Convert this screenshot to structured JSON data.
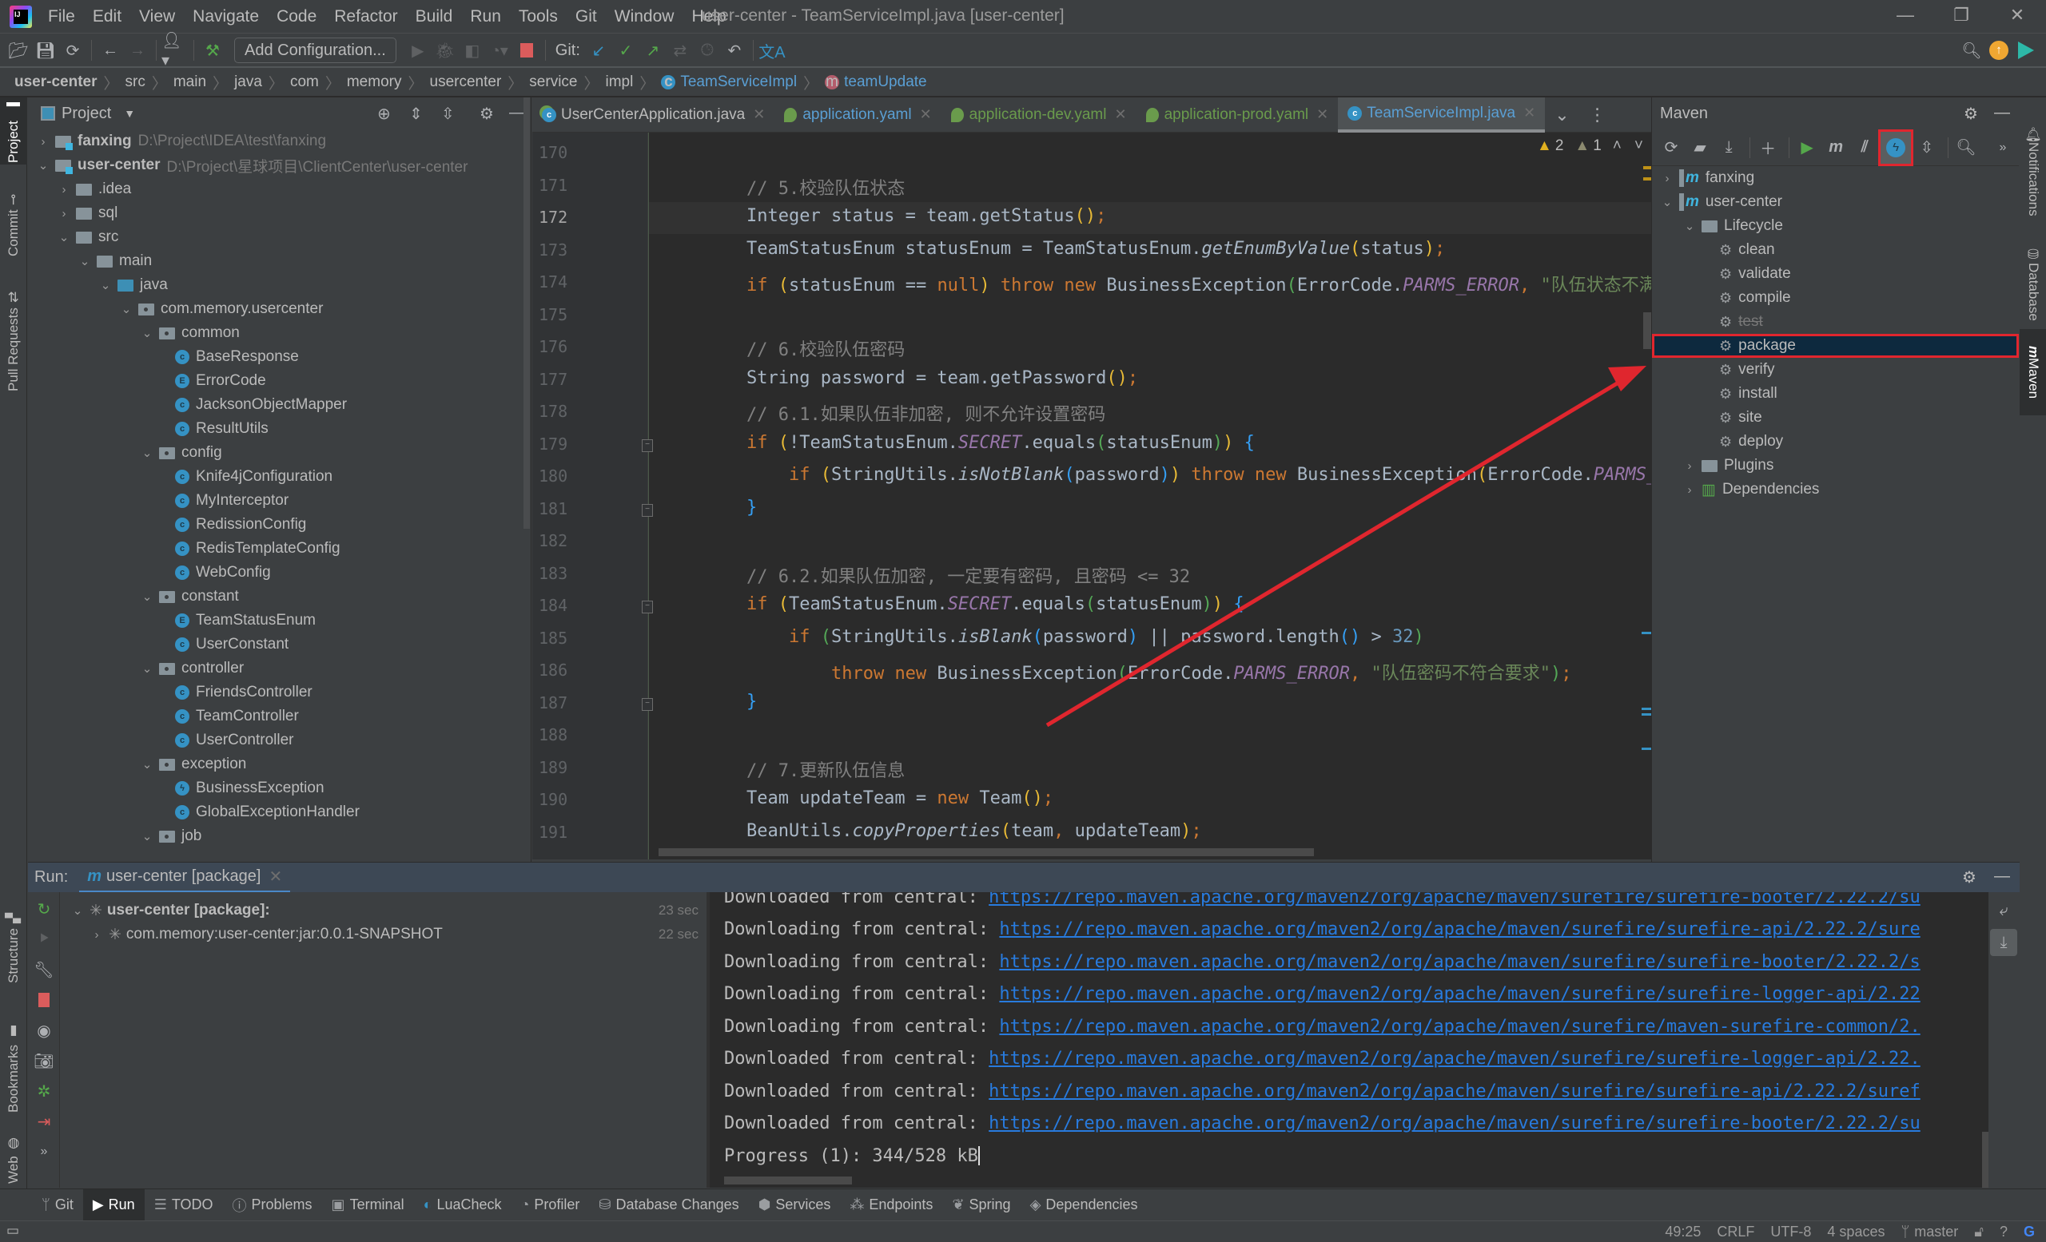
{
  "window": {
    "title": "user-center - TeamServiceImpl.java [user-center]",
    "menu": [
      "File",
      "Edit",
      "View",
      "Navigate",
      "Code",
      "Refactor",
      "Build",
      "Run",
      "Tools",
      "Git",
      "Window",
      "Help"
    ],
    "controls": {
      "minimize": "—",
      "restore": "❐",
      "close": "✕"
    }
  },
  "toolbar": {
    "add_configuration": "Add Configuration...",
    "git_label": "Git:"
  },
  "breadcrumb": {
    "items": [
      "user-center",
      "src",
      "main",
      "java",
      "com",
      "memory",
      "usercenter",
      "service",
      "impl",
      "TeamServiceImpl",
      "teamUpdate"
    ]
  },
  "left_stripe": {
    "project": "Project",
    "commit": "Commit",
    "pull_requests": "Pull Requests",
    "structure": "Structure",
    "bookmarks": "Bookmarks",
    "web": "Web"
  },
  "right_stripe": {
    "notifications": "Notifications",
    "database": "Database",
    "maven": "Maven"
  },
  "project_panel": {
    "title": "Project",
    "tree": [
      {
        "label": "fanxing",
        "path": "D:\\Project\\IDEA\\test\\fanxing",
        "type": "module",
        "expanded": false,
        "depth": 0
      },
      {
        "label": "user-center",
        "path": "D:\\Project\\星球项目\\ClientCenter\\user-center",
        "type": "module",
        "expanded": true,
        "depth": 0
      },
      {
        "label": ".idea",
        "type": "folder",
        "expanded": false,
        "depth": 1
      },
      {
        "label": "sql",
        "type": "folder",
        "expanded": false,
        "depth": 1
      },
      {
        "label": "src",
        "type": "folder",
        "expanded": true,
        "depth": 1
      },
      {
        "label": "main",
        "type": "folder",
        "expanded": true,
        "depth": 2
      },
      {
        "label": "java",
        "type": "source",
        "expanded": true,
        "depth": 3
      },
      {
        "label": "com.memory.usercenter",
        "type": "package",
        "expanded": true,
        "depth": 4
      },
      {
        "label": "common",
        "type": "package",
        "expanded": true,
        "depth": 5
      },
      {
        "label": "BaseResponse",
        "type": "class",
        "depth": 6
      },
      {
        "label": "ErrorCode",
        "type": "enum",
        "depth": 6
      },
      {
        "label": "JacksonObjectMapper",
        "type": "class",
        "depth": 6
      },
      {
        "label": "ResultUtils",
        "type": "class",
        "depth": 6
      },
      {
        "label": "config",
        "type": "package",
        "expanded": true,
        "depth": 5
      },
      {
        "label": "Knife4jConfiguration",
        "type": "class",
        "depth": 6
      },
      {
        "label": "MyInterceptor",
        "type": "class",
        "depth": 6
      },
      {
        "label": "RedissionConfig",
        "type": "class",
        "depth": 6
      },
      {
        "label": "RedisTemplateConfig",
        "type": "class",
        "depth": 6
      },
      {
        "label": "WebConfig",
        "type": "class",
        "depth": 6
      },
      {
        "label": "constant",
        "type": "package",
        "expanded": true,
        "depth": 5
      },
      {
        "label": "TeamStatusEnum",
        "type": "enum",
        "depth": 6
      },
      {
        "label": "UserConstant",
        "type": "class",
        "depth": 6
      },
      {
        "label": "controller",
        "type": "package",
        "expanded": true,
        "depth": 5
      },
      {
        "label": "FriendsController",
        "type": "class",
        "depth": 6
      },
      {
        "label": "TeamController",
        "type": "class",
        "depth": 6
      },
      {
        "label": "UserController",
        "type": "class",
        "depth": 6
      },
      {
        "label": "exception",
        "type": "package",
        "expanded": true,
        "depth": 5
      },
      {
        "label": "BusinessException",
        "type": "exception",
        "depth": 6
      },
      {
        "label": "GlobalExceptionHandler",
        "type": "class",
        "depth": 6
      },
      {
        "label": "job",
        "type": "package",
        "expanded": true,
        "depth": 5
      }
    ]
  },
  "editor": {
    "tabs": [
      {
        "label": "UserCenterApplication.java",
        "kind": "spring-class",
        "active": false
      },
      {
        "label": "application.yaml",
        "kind": "yaml",
        "active": false
      },
      {
        "label": "application-dev.yaml",
        "kind": "yaml",
        "active": false
      },
      {
        "label": "application-prod.yaml",
        "kind": "yaml",
        "active": false
      },
      {
        "label": "TeamServiceImpl.java",
        "kind": "class",
        "active": true
      }
    ],
    "inspections": {
      "warnings": "2",
      "weak_warnings": "1"
    },
    "current_line": 172,
    "lines": [
      {
        "n": "170",
        "html": ""
      },
      {
        "n": "171",
        "html": "<span class='cm'>// 5.校验队伍状态</span>"
      },
      {
        "n": "172",
        "html": "Integer status = team.getStatus<span class='p1'>()</span><span class='kw'>;</span>"
      },
      {
        "n": "173",
        "html": "TeamStatusEnum statusEnum = TeamStatusEnum.<span class='it'>getEnumByValue</span><span class='p1'>(</span>status<span class='p1'>)</span><span class='kw'>;</span>"
      },
      {
        "n": "174",
        "html": "<span class='kw'>if</span> <span class='p1'>(</span>statusEnum == <span class='kw'>null</span><span class='p1'>)</span> <span class='kw'>throw new</span> BusinessException<span class='p2'>(</span>ErrorCode.<span class='fd'>PARMS_ERROR</span><span class='kw'>,</span> <span class='st'>\"队伍状态不满足要求\"</span><span class='p2'>)</span><span class='kw'>;</span>"
      },
      {
        "n": "175",
        "html": ""
      },
      {
        "n": "176",
        "html": "<span class='cm'>// 6.校验队伍密码</span>"
      },
      {
        "n": "177",
        "html": "String password = team.getPassword<span class='p1'>()</span><span class='kw'>;</span>"
      },
      {
        "n": "178",
        "html": "<span class='cm'>// 6.1.如果队伍非加密, 则不允许设置密码</span>"
      },
      {
        "n": "179",
        "html": "<span class='kw'>if</span> <span class='p1'>(</span>!TeamStatusEnum.<span class='fd'>SECRET</span>.equals<span class='p2'>(</span>statusEnum<span class='p2'>)</span><span class='p1'>)</span> <span class='p3'>{</span>"
      },
      {
        "n": "180",
        "html": "    <span class='kw'>if</span> <span class='p1'>(</span>StringUtils.<span class='it'>isNotBlank</span><span class='p3'>(</span>password<span class='p3'>)</span><span class='p1'>)</span> <span class='kw'>throw new</span> BusinessException<span class='p1'>(</span>ErrorCode.<span class='fd'>PARMS_ERROR</span><span class='kw'>,</span> <span class='st'>\"\"</span><span class='p1'>)</span><span class='kw'>;</span>"
      },
      {
        "n": "181",
        "html": "<span class='p3'>}</span>"
      },
      {
        "n": "182",
        "html": ""
      },
      {
        "n": "183",
        "html": "<span class='cm'>// 6.2.如果队伍加密, 一定要有密码, 且密码 &lt;= 32</span>"
      },
      {
        "n": "184",
        "html": "<span class='kw'>if</span> <span class='p1'>(</span>TeamStatusEnum.<span class='fd'>SECRET</span>.equals<span class='p2'>(</span>statusEnum<span class='p2'>)</span><span class='p1'>)</span> <span class='p3'>{</span>"
      },
      {
        "n": "185",
        "html": "    <span class='kw'>if</span> <span class='p2'>(</span>StringUtils.<span class='it'>isBlank</span><span class='p3'>(</span>password<span class='p3'>)</span> || password.length<span class='p3'>()</span> &gt; <span class='nm'>32</span><span class='p2'>)</span>"
      },
      {
        "n": "186",
        "html": "        <span class='kw'>throw new</span> BusinessException<span class='p2'>(</span>ErrorCode.<span class='fd'>PARMS_ERROR</span><span class='kw'>,</span> <span class='st'>\"队伍密码不符合要求\"</span><span class='p2'>)</span><span class='kw'>;</span>"
      },
      {
        "n": "187",
        "html": "<span class='p3'>}</span>"
      },
      {
        "n": "188",
        "html": ""
      },
      {
        "n": "189",
        "html": "<span class='cm'>// 7.更新队伍信息</span>"
      },
      {
        "n": "190",
        "html": "Team updateTeam = <span class='kw'>new</span> Team<span class='p1'>()</span><span class='kw'>;</span>"
      },
      {
        "n": "191",
        "html": "BeanUtils.<span class='it'>copyProperties</span><span class='p1'>(</span>team<span class='kw'>,</span> updateTeam<span class='p1'>)</span><span class='kw'>;</span>"
      }
    ]
  },
  "maven_panel": {
    "title": "Maven",
    "tree": [
      {
        "label": "fanxing",
        "type": "project",
        "expanded": false,
        "depth": 0
      },
      {
        "label": "user-center",
        "type": "project",
        "expanded": true,
        "depth": 0
      },
      {
        "label": "Lifecycle",
        "type": "group",
        "expanded": true,
        "depth": 1
      },
      {
        "label": "clean",
        "type": "goal",
        "depth": 2
      },
      {
        "label": "validate",
        "type": "goal",
        "depth": 2
      },
      {
        "label": "compile",
        "type": "goal",
        "depth": 2
      },
      {
        "label": "test",
        "type": "goal",
        "depth": 2,
        "skipped": true
      },
      {
        "label": "package",
        "type": "goal",
        "depth": 2,
        "selected": true
      },
      {
        "label": "verify",
        "type": "goal",
        "depth": 2
      },
      {
        "label": "install",
        "type": "goal",
        "depth": 2
      },
      {
        "label": "site",
        "type": "goal",
        "depth": 2
      },
      {
        "label": "deploy",
        "type": "goal",
        "depth": 2
      },
      {
        "label": "Plugins",
        "type": "group",
        "expanded": false,
        "depth": 1
      },
      {
        "label": "Dependencies",
        "type": "deps",
        "expanded": false,
        "depth": 1
      }
    ]
  },
  "run_panel": {
    "label": "Run:",
    "tab": "user-center [package]",
    "tree": [
      {
        "label": "user-center [package]:",
        "time": "23 sec",
        "bold": true
      },
      {
        "label": "com.memory:user-center:jar:0.0.1-SNAPSHOT",
        "time": "22 sec",
        "bold": false
      }
    ],
    "console": [
      {
        "prefix": "Downloaded from central: ",
        "url": "https://repo.maven.apache.org/maven2/org/apache/maven/surefire/surefire-booter/2.22.2/su"
      },
      {
        "prefix": "Downloading from central: ",
        "url": "https://repo.maven.apache.org/maven2/org/apache/maven/surefire/surefire-api/2.22.2/sure"
      },
      {
        "prefix": "Downloading from central: ",
        "url": "https://repo.maven.apache.org/maven2/org/apache/maven/surefire/surefire-booter/2.22.2/s"
      },
      {
        "prefix": "Downloading from central: ",
        "url": "https://repo.maven.apache.org/maven2/org/apache/maven/surefire/surefire-logger-api/2.22"
      },
      {
        "prefix": "Downloading from central: ",
        "url": "https://repo.maven.apache.org/maven2/org/apache/maven/surefire/maven-surefire-common/2."
      },
      {
        "prefix": "Downloaded from central: ",
        "url": "https://repo.maven.apache.org/maven2/org/apache/maven/surefire/surefire-logger-api/2.22."
      },
      {
        "prefix": "Downloaded from central: ",
        "url": "https://repo.maven.apache.org/maven2/org/apache/maven/surefire/surefire-api/2.22.2/suref"
      },
      {
        "prefix": "Downloaded from central: ",
        "url": "https://repo.maven.apache.org/maven2/org/apache/maven/surefire/surefire-booter/2.22.2/su"
      },
      {
        "prefix": "Progress (1): 344/528 kB",
        "url": ""
      }
    ]
  },
  "bottom_tools": [
    {
      "label": "Git",
      "icon": "git-branch-icon"
    },
    {
      "label": "Run",
      "icon": "run-icon",
      "active": true
    },
    {
      "label": "TODO",
      "icon": "todo-icon"
    },
    {
      "label": "Problems",
      "icon": "problems-icon"
    },
    {
      "label": "Terminal",
      "icon": "terminal-icon"
    },
    {
      "label": "LuaCheck",
      "icon": "luacheck-icon"
    },
    {
      "label": "Profiler",
      "icon": "profiler-icon"
    },
    {
      "label": "Database Changes",
      "icon": "database-changes-icon"
    },
    {
      "label": "Services",
      "icon": "services-icon"
    },
    {
      "label": "Endpoints",
      "icon": "endpoints-icon"
    },
    {
      "label": "Spring",
      "icon": "spring-icon"
    },
    {
      "label": "Dependencies",
      "icon": "dependencies-icon"
    }
  ],
  "status_bar": {
    "position": "49:25",
    "line_ending": "CRLF",
    "encoding": "UTF-8",
    "indent": "4 spaces",
    "branch": "master"
  },
  "colors": {
    "accent": "#4a88c7",
    "highlight_box": "#e0262e",
    "selection": "#0d293e",
    "link": "#287bde"
  }
}
